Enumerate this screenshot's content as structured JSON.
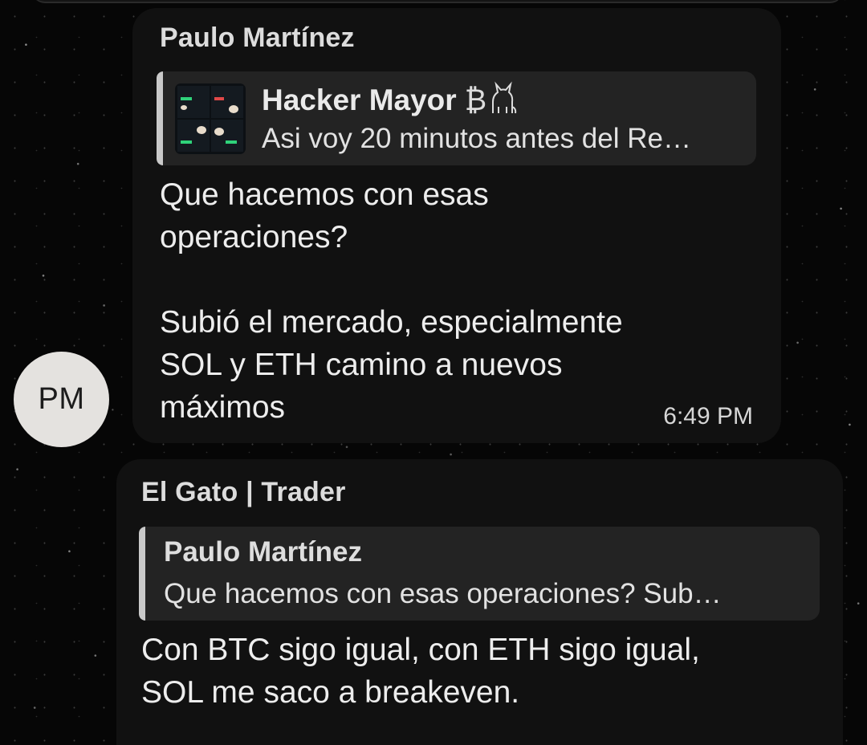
{
  "messages": [
    {
      "sender": "Paulo Martínez",
      "avatar_initials": "PM",
      "reply": {
        "title": "Hacker Mayor",
        "title_symbol": "₿",
        "title_icon": "cat-icon",
        "snippet": "Asi voy 20 minutos antes del Re…",
        "thumbnail": "trading-screenshot-thumbnail"
      },
      "lines": [
        "Que hacemos con esas",
        "operaciones?",
        "",
        "Subió el mercado, especialmente",
        "SOL y ETH camino a nuevos",
        "máximos"
      ],
      "time": "6:49 PM"
    },
    {
      "sender": "El Gato | Trader",
      "reply": {
        "title": "Paulo Martínez",
        "snippet": "Que hacemos con esas operaciones?   Sub…"
      },
      "lines": [
        "Con BTC sigo igual, con ETH sigo igual,",
        "SOL me saco a breakeven."
      ]
    }
  ],
  "colors": {
    "background": "#060606",
    "bubble": "#111111",
    "reply_card": "#232323",
    "reply_bar": "#c9c9c9",
    "avatar": "#e4e2df"
  }
}
